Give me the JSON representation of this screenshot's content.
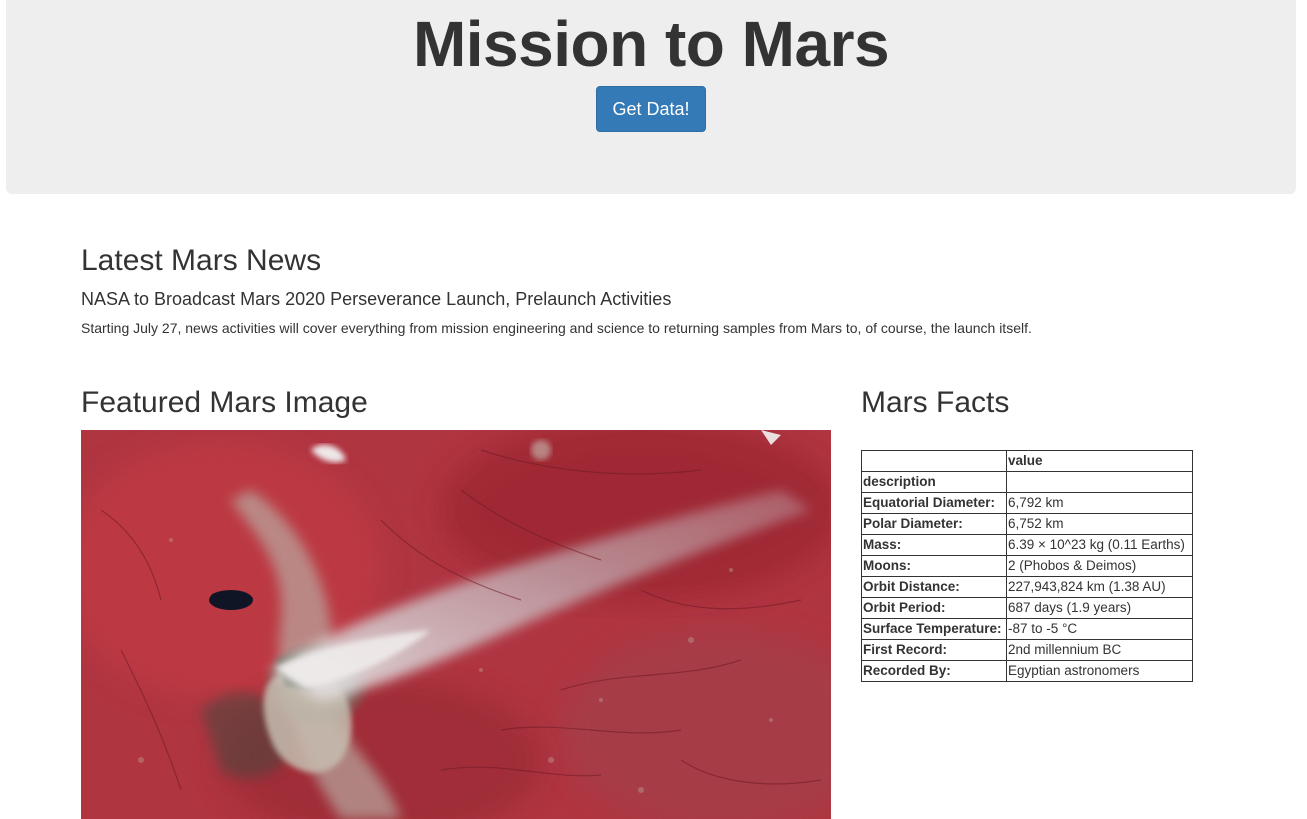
{
  "header": {
    "title": "Mission to Mars",
    "button_label": "Get Data!"
  },
  "news": {
    "heading": "Latest Mars News",
    "title": "NASA to Broadcast Mars 2020 Perseverance Launch, Prelaunch Activities",
    "teaser": "Starting July 27, news activities will cover everything from mission engineering and science to returning samples from Mars to, of course, the launch itself."
  },
  "featured": {
    "heading": "Featured Mars Image"
  },
  "facts": {
    "heading": "Mars Facts",
    "columns": [
      "",
      "value"
    ],
    "index_label": "description",
    "rows": [
      {
        "label": "Equatorial Diameter:",
        "value": "6,792 km"
      },
      {
        "label": "Polar Diameter:",
        "value": "6,752 km"
      },
      {
        "label": "Mass:",
        "value": "6.39 × 10^23 kg (0.11 Earths)"
      },
      {
        "label": "Moons:",
        "value": "2 (Phobos & Deimos)"
      },
      {
        "label": "Orbit Distance:",
        "value": "227,943,824 km (1.38 AU)"
      },
      {
        "label": "Orbit Period:",
        "value": "687 days (1.9 years)"
      },
      {
        "label": "Surface Temperature:",
        "value": "-87 to -5 °C"
      },
      {
        "label": "First Record:",
        "value": "2nd millennium BC"
      },
      {
        "label": "Recorded By:",
        "value": "Egyptian astronomers"
      }
    ]
  },
  "colors": {
    "jumbotron_bg": "#eeeeee",
    "button_bg": "#337ab7",
    "text": "#333333",
    "image_red": "#b2313f",
    "smoke": "#c8c4c8"
  }
}
